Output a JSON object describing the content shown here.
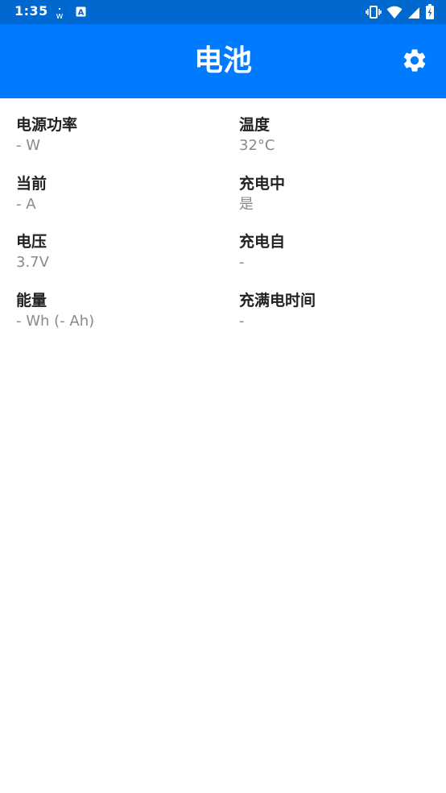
{
  "status_bar": {
    "time": "1:35",
    "notification_icons": [
      "w-icon",
      "a-icon"
    ],
    "system_icons": [
      "vibrate-icon",
      "wifi-icon",
      "signal-icon",
      "battery-icon"
    ]
  },
  "app_bar": {
    "title": "电池",
    "settings_icon": "gear-icon"
  },
  "stats": [
    {
      "label": "电源功率",
      "value": "- W"
    },
    {
      "label": "温度",
      "value": "32°C"
    },
    {
      "label": "当前",
      "value": "- A"
    },
    {
      "label": "充电中",
      "value": "是"
    },
    {
      "label": "电压",
      "value": "3.7V"
    },
    {
      "label": "充电自",
      "value": "-"
    },
    {
      "label": "能量",
      "value": "- Wh (- Ah)"
    },
    {
      "label": "充满电时间",
      "value": "-"
    }
  ],
  "colors": {
    "status_bar": "#0068cf",
    "app_bar": "#007bff",
    "label": "#222222",
    "value": "#8a8a8a"
  }
}
